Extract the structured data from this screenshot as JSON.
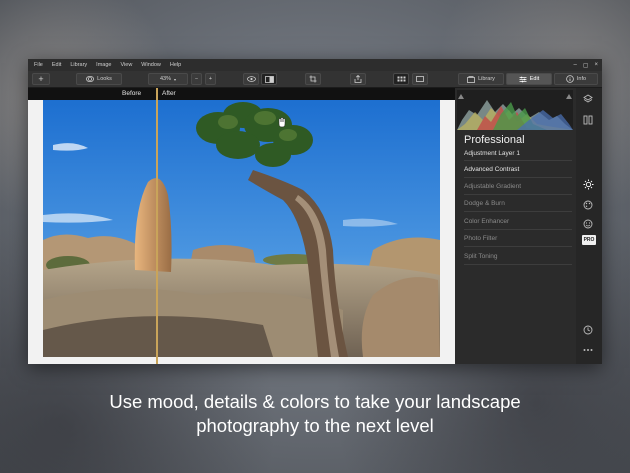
{
  "menu": [
    "File",
    "Edit",
    "Library",
    "Image",
    "View",
    "Window",
    "Help"
  ],
  "window_controls": [
    "–",
    "▢",
    "×"
  ],
  "toolbar": {
    "add": "+",
    "looks": "Looks",
    "zoom": "43%",
    "zoom_out": "−",
    "zoom_in": "+",
    "library": "Library",
    "edit": "Edit",
    "info": "Info"
  },
  "compare": {
    "before": "Before",
    "after": "After"
  },
  "panel": {
    "title": "Professional",
    "adjustment_layer": "Adjustment Layer 1",
    "filters": [
      "Advanced Contrast",
      "Adjustable Gradient",
      "Dodge & Burn",
      "Color Enhancer",
      "Photo Filter",
      "Split Toning"
    ],
    "pro_badge": "PRO"
  },
  "caption": {
    "line1": "Use mood, details & colors to take your landscape",
    "line2": "photography to the next level"
  },
  "colors": {
    "accent_divider": "#c9a45a",
    "panel_bg": "#2b2b2b",
    "toolbar_bg": "#333333"
  }
}
